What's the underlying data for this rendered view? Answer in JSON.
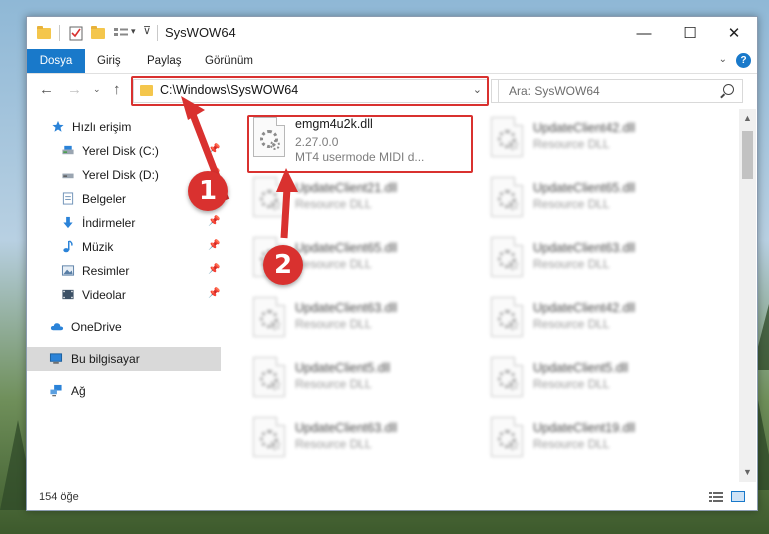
{
  "window": {
    "title": "SysWOW64",
    "minimize_glyph": "—",
    "maximize_glyph": "☐",
    "close_glyph": "✕"
  },
  "ribbon": {
    "tabs": [
      {
        "label": "Dosya",
        "active": true
      },
      {
        "label": "Giriş"
      },
      {
        "label": "Paylaş"
      },
      {
        "label": "Görünüm"
      }
    ],
    "help": "?"
  },
  "nav": {
    "address": "C:\\Windows\\SysWOW64",
    "search_placeholder": "Ara: SysWOW64"
  },
  "sidebar": {
    "items": [
      {
        "label": "Hızlı erişim",
        "icon": "star-icon"
      },
      {
        "label": "Yerel Disk (C:)",
        "icon": "drive-icon"
      },
      {
        "label": "Yerel Disk (D:)",
        "icon": "drive-icon"
      },
      {
        "label": "Belgeler",
        "icon": "documents-icon"
      },
      {
        "label": "İndirmeler",
        "icon": "download-icon"
      },
      {
        "label": "Müzik",
        "icon": "music-icon"
      },
      {
        "label": "Resimler",
        "icon": "pictures-icon"
      },
      {
        "label": "Videolar",
        "icon": "videos-icon"
      },
      {
        "label": "OneDrive",
        "icon": "cloud-icon"
      },
      {
        "label": "Bu bilgisayar",
        "icon": "computer-icon",
        "selected": true
      },
      {
        "label": "Ağ",
        "icon": "network-icon"
      }
    ]
  },
  "files": [
    {
      "name": "emgm4u2k.dll",
      "version": "2.27.0.0",
      "description": "MT4 usermode MIDI d..."
    },
    {
      "name": "UpdateClient42.dll",
      "type": "Resource DLL"
    },
    {
      "name": "UpdateClient21.dll",
      "type": "Resource DLL"
    },
    {
      "name": "UpdateClient65.dll",
      "type": "Resource DLL"
    },
    {
      "name": "UpdateClient65.dll",
      "type": "Resource DLL"
    },
    {
      "name": "UpdateClient63.dll",
      "type": "Resource DLL"
    },
    {
      "name": "UpdateClient63.dll",
      "type": "Resource DLL"
    },
    {
      "name": "UpdateClient42.dll",
      "type": "Resource DLL"
    },
    {
      "name": "UpdateClient5.dll",
      "type": "Resource DLL"
    },
    {
      "name": "UpdateClient5.dll",
      "type": "Resource DLL"
    },
    {
      "name": "UpdateClient63.dll",
      "type": "Resource DLL"
    },
    {
      "name": "UpdateClient19.dll",
      "type": "Resource DLL"
    }
  ],
  "status": {
    "count": "154 öğe"
  },
  "markers": {
    "one": "1",
    "two": "2"
  },
  "colors": {
    "accent": "#1979ca",
    "highlight": "#d9312f",
    "folder": "#f4c64c"
  }
}
